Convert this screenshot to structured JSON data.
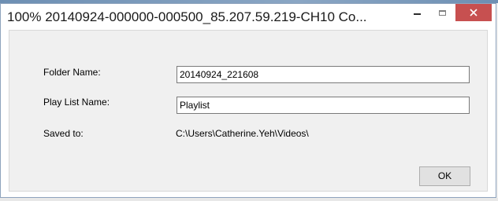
{
  "window": {
    "title": "100% 20140924-000000-000500_85.207.59.219-CH10 Co...",
    "controls": {
      "minimize_icon": "minimize-icon",
      "maximize_icon": "maximize-icon",
      "close_icon": "close-icon",
      "close_color": "#c75050"
    }
  },
  "form": {
    "folder_name": {
      "label": "Folder Name:",
      "value": "20140924_221608"
    },
    "playlist_name": {
      "label": "Play List Name:",
      "value": "Playlist"
    },
    "saved_to": {
      "label": "Saved to:",
      "value": "C:\\Users\\Catherine.Yeh\\Videos\\"
    }
  },
  "buttons": {
    "ok_label": "OK"
  }
}
